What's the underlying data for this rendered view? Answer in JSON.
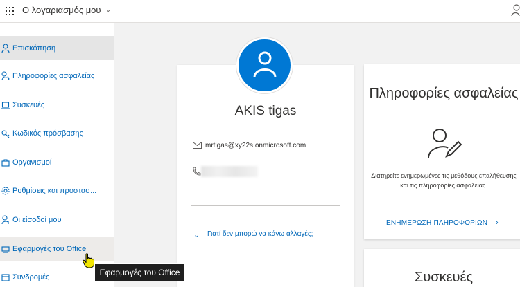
{
  "header": {
    "title": "Ο λογαριασμός μου",
    "icons": {
      "app_launcher": "waffle-icon",
      "account": "person-icon"
    }
  },
  "sidebar": {
    "items": [
      {
        "label": "Επισκόπηση",
        "icon": "person-icon",
        "state": "active"
      },
      {
        "label": "Πληροφορίες ασφαλείας",
        "icon": "security-key-icon"
      },
      {
        "label": "Συσκευές",
        "icon": "laptop-icon"
      },
      {
        "label": "Κωδικός πρόσβασης",
        "icon": "key-icon"
      },
      {
        "label": "Οργανισμοί",
        "icon": "briefcase-icon"
      },
      {
        "label": "Ρυθμίσεις και προστασ...",
        "icon": "settings-icon"
      },
      {
        "label": "Οι είσοδοί μου",
        "icon": "signin-icon"
      },
      {
        "label": "Εφαρμογές του Office",
        "icon": "office-apps-icon",
        "state": "hover"
      },
      {
        "label": "Συνδρομές",
        "icon": "subscriptions-icon"
      }
    ]
  },
  "profile": {
    "name": "AKIS tigas",
    "email": "mrtigas@xy22s.onmicrosoft.com",
    "phone": "",
    "why_link": "Γιατί δεν μπορώ να κάνω αλλαγές;"
  },
  "security_card": {
    "title": "Πληροφορίες ασφαλείας",
    "description": "Διατηρείτε ενημερωμένες τις μεθόδους επαλήθευσης και τις πληροφορίες ασφαλείας.",
    "link": "ΕΝΗΜΕΡΩΣΗ ΠΛΗΡΟΦΟΡΙΩΝ"
  },
  "devices_card": {
    "title": "Συσκευές"
  },
  "tooltip": {
    "text": "Εφαρμογές του Office"
  },
  "colors": {
    "accent": "#0078d4",
    "link": "#0067b8",
    "active_nav": "#e5e5e5"
  }
}
